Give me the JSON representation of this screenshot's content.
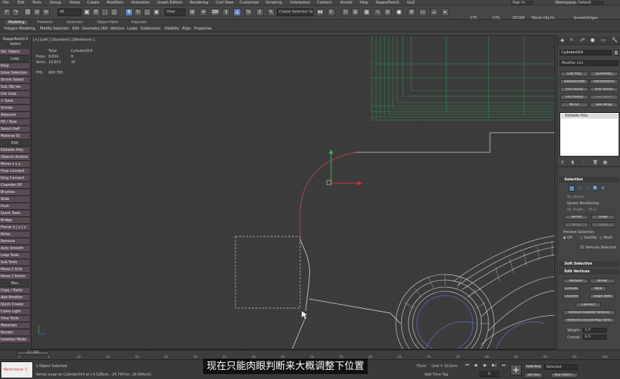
{
  "menu": [
    "File",
    "Edit",
    "Tools",
    "Group",
    "Views",
    "Create",
    "Modifiers",
    "Animation",
    "Graph Editors",
    "Rendering",
    "Civil View",
    "Customize",
    "Scripting",
    "Interactive",
    "Content",
    "Arnold",
    "Help",
    "RappaTools3",
    "GoZ"
  ],
  "signin": "Sign In",
  "workspace_label": "Workspaces:",
  "workspace_value": "Default",
  "toolbar": {
    "filter_all": "All",
    "view": "View",
    "selection_set": "Create Selection Se",
    "right_labels": [
      "CTS",
      "DTS",
      "3PCRM",
      "*Bezik-Obj Po",
      "SmoothEdges"
    ]
  },
  "ribbon": {
    "tabs": [
      "Modeling",
      "Freeform",
      "Selection",
      "Object Paint",
      "Populate"
    ],
    "sub": [
      "Polygon Modeling",
      "Modify Selection",
      "Edit",
      "Geometry (All)",
      "Vertices",
      "Loops",
      "Subdivision",
      "Visibility",
      "Align",
      "Properties"
    ]
  },
  "left_panel": {
    "title1": "RappaTools3.5",
    "title2": "Select",
    "items": [
      "Sel. Object",
      "Loop",
      "Ring",
      "Grow Selection",
      "Shrink Select",
      "Sub Obj Iso",
      "Dot Loop",
      "+ Save",
      "Similar",
      "Adjacent",
      "Fill / Hole",
      "Select Half",
      "Material ID",
      "Edit",
      "Editable Poly",
      "Objects Actions",
      "Mirror  x  y  z",
      "Flow Connect",
      "Ring Connect",
      "Chamfer OP",
      "Brushes",
      "Slide",
      "Push",
      "Quick Tools",
      "Bridge",
      "Planar  x | y | z",
      "Relax",
      "Remove",
      "Auto Smooth",
      "Loop Tools",
      "Sub Tools",
      "Move 2 Grid",
      "Move 2 Points",
      "Misc",
      "Copy / Paste",
      "Add Modifier",
      "Quick Create",
      "Camo Light",
      "View Tools",
      "Materials",
      "Render",
      "Isolation Mode"
    ],
    "headers": [
      1,
      13,
      33
    ]
  },
  "viewport": {
    "label": "[+] [Left ] [Standard ] [Wireframe ]",
    "stats": {
      "total_label": "Total",
      "object_name": "Cylinder014",
      "polys_label": "Polys:",
      "polys_total": "8,816",
      "polys_obj": "8",
      "verts_label": "Verts:",
      "verts_total": "10,810",
      "verts_obj": "32",
      "fps_label": "FPS:",
      "fps_value": "600.765"
    }
  },
  "right_panel": {
    "object_name": "Cylinder014",
    "modifier_list": "Modifier List",
    "mod_buttons": [
      "Edit Poly",
      "Symmetry",
      "TurboSmooth",
      "FetchDeform",
      "FFD 2x2x2",
      "FFD 3x3x3",
      "FFD 4x4x4",
      "FFD select",
      "Mirror",
      "Skin Wrap"
    ],
    "stack_item": "Editable Poly",
    "selection_title": "Selection",
    "by_vertex": "By Vertex",
    "ignore_backfacing": "Ignore Backfacing",
    "by_angle": "By Angle:",
    "by_angle_value": "45.0",
    "shrink": "Shrink",
    "grow": "Grow",
    "ring": "Ring",
    "loop": "Loop",
    "preview_selection": "Preview Selection",
    "preview_opts": [
      "Off",
      "SubObj",
      "Multi"
    ],
    "selected_count": "32 Vertices Selected",
    "soft_selection": "Soft Selection",
    "edit_vertices": "Edit Vertices",
    "ev_buttons": [
      "Remove",
      "Break",
      "Extrude",
      "Weld",
      "Chamfer",
      "Target Weld"
    ],
    "connect": "Connect",
    "remove_isolated": "Remove Isolated Vertices",
    "remove_unused": "Remove Unused Map Verts",
    "weight_label": "Weight:",
    "weight_value": "1.0",
    "crease_label": "Crease:",
    "crease_value": "0.0"
  },
  "timeline": {
    "frame": "0 / 100",
    "ticks": [
      "0",
      "5",
      "10",
      "15",
      "20",
      "25",
      "30",
      "35",
      "40",
      "45",
      "50",
      "55",
      "60",
      "65",
      "70",
      "75",
      "80",
      "85",
      "90",
      "95",
      "100"
    ]
  },
  "status": {
    "script_field": "'Reference C",
    "selected": "1 Object Selected",
    "snap_msg": "Vertex snap on Cylinder014 at [-4.528cm, -24.797cm, 19.006cm]",
    "unit": "75cm",
    "grid": "Grid = 10.0cm",
    "add_time_tag": "Add Time Tag",
    "auto_key": "Auto Key",
    "set_key": "Set Key",
    "selected_dd": "Selected",
    "key_filters": "Key Filters...",
    "frame_value": "0"
  },
  "subtitle": "现在只能肉眼判断来大概调整下位置"
}
